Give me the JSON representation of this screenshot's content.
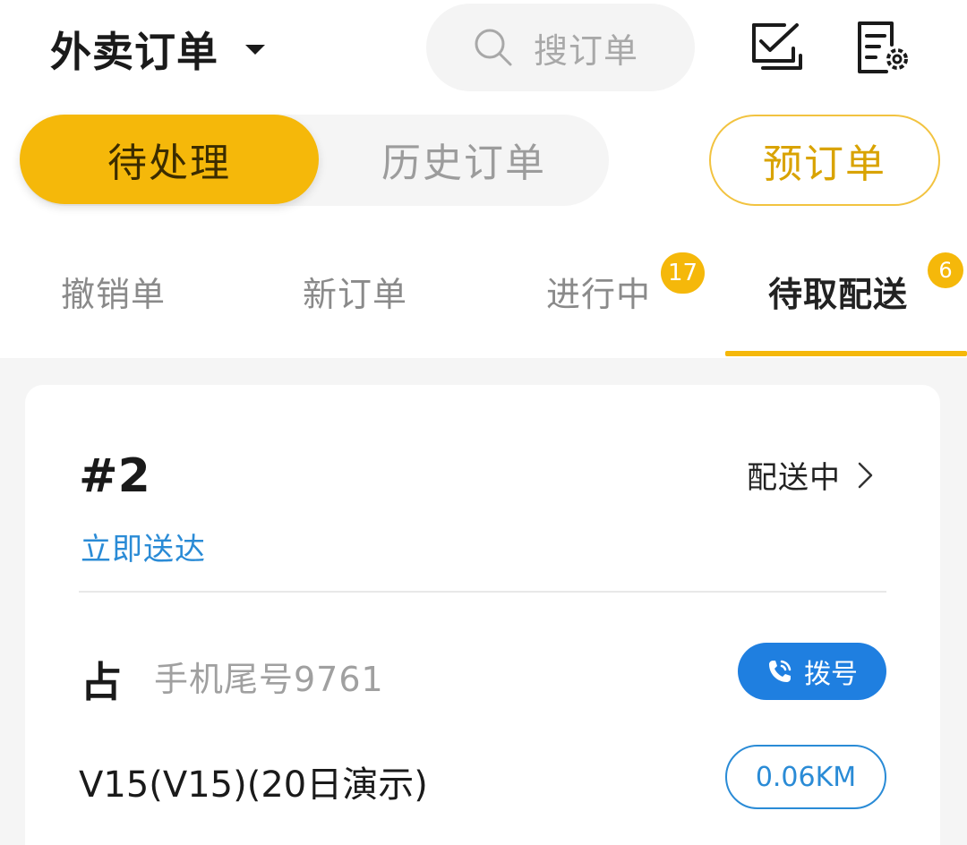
{
  "header": {
    "title": "外卖订单",
    "title_icon": "caret-down-icon",
    "search_placeholder": "搜订单",
    "search_icon": "search-icon",
    "actions": [
      {
        "icon": "checklist-icon"
      },
      {
        "icon": "document-settings-icon"
      }
    ]
  },
  "segments": {
    "active": "待处理",
    "inactive": "历史订单",
    "preorder": "预订单"
  },
  "tabs": [
    {
      "label": "撤销单",
      "badge": ""
    },
    {
      "label": "新订单",
      "badge": ""
    },
    {
      "label": "进行中",
      "badge": "17"
    },
    {
      "label": "待取配送",
      "badge": "6",
      "selected": true
    }
  ],
  "order": {
    "number": "#2",
    "status": "配送中",
    "delivery_time": "立即送达",
    "customer_surname": "占",
    "phone_tail": "手机尾号9761",
    "dial_label": "拨号",
    "address": "V15(V15)(20日演示)",
    "distance": "0.06KM"
  },
  "colors": {
    "accent": "#f5b80a",
    "link_blue": "#2a8bd6",
    "dial_blue": "#1f7fe0"
  }
}
